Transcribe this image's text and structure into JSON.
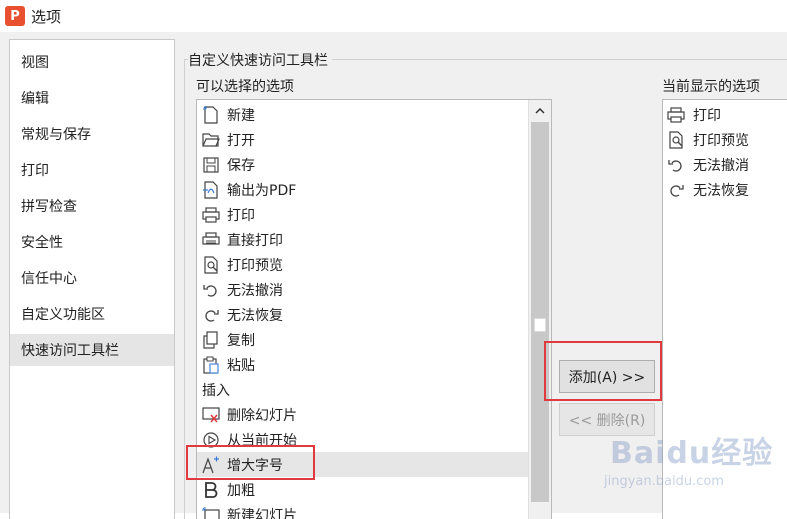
{
  "window": {
    "title": "选项",
    "logo_letter": "P"
  },
  "nav": {
    "items": [
      {
        "label": "视图"
      },
      {
        "label": "编辑"
      },
      {
        "label": "常规与保存"
      },
      {
        "label": "打印"
      },
      {
        "label": "拼写检查"
      },
      {
        "label": "安全性"
      },
      {
        "label": "信任中心"
      },
      {
        "label": "自定义功能区"
      },
      {
        "label": "快速访问工具栏",
        "active": true
      }
    ]
  },
  "main": {
    "group_title": "自定义快速访问工具栏",
    "available_label": "可以选择的选项",
    "current_label": "当前显示的选项",
    "available_items": [
      {
        "label": "新建",
        "icon": "new-doc-icon"
      },
      {
        "label": "打开",
        "icon": "folder-open-icon"
      },
      {
        "label": "保存",
        "icon": "save-icon"
      },
      {
        "label": "输出为PDF",
        "icon": "export-pdf-icon"
      },
      {
        "label": "打印",
        "icon": "print-icon"
      },
      {
        "label": "直接打印",
        "icon": "direct-print-icon"
      },
      {
        "label": "打印预览",
        "icon": "print-preview-icon"
      },
      {
        "label": "无法撤消",
        "icon": "undo-icon"
      },
      {
        "label": "无法恢复",
        "icon": "redo-icon"
      },
      {
        "label": "复制",
        "icon": "copy-icon"
      },
      {
        "label": "粘贴",
        "icon": "paste-icon"
      },
      {
        "label": "插入",
        "icon": ""
      },
      {
        "label": "删除幻灯片",
        "icon": "delete-slide-icon"
      },
      {
        "label": "从当前开始",
        "icon": "play-from-current-icon"
      },
      {
        "label": "增大字号",
        "icon": "increase-font-icon",
        "selected": true
      },
      {
        "label": "加粗",
        "icon": "bold-icon"
      },
      {
        "label": "新建幻灯片",
        "icon": "new-slide-icon"
      }
    ],
    "current_items": [
      {
        "label": "打印",
        "icon": "print-icon"
      },
      {
        "label": "打印预览",
        "icon": "print-preview-icon"
      },
      {
        "label": "无法撤消",
        "icon": "undo-icon"
      },
      {
        "label": "无法恢复",
        "icon": "redo-icon"
      }
    ],
    "add_button": "添加(A) >>",
    "remove_button": "<< 删除(R)"
  },
  "watermark": {
    "text": "Baidu经验",
    "sub": "jingyan.baidu.com"
  },
  "colors": {
    "highlight_box": "#e0393e",
    "logo": "#e8502f"
  }
}
